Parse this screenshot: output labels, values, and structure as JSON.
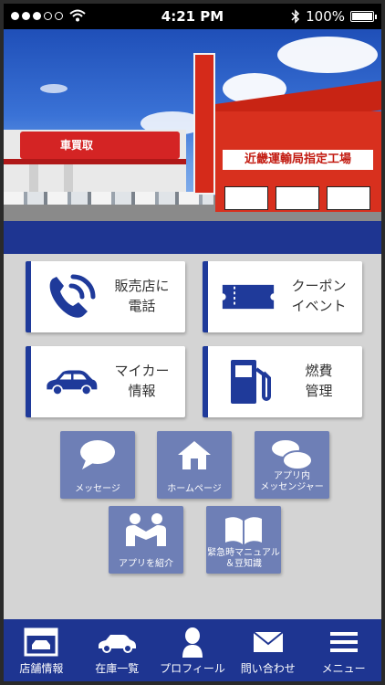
{
  "status_bar": {
    "time": "4:21 PM",
    "battery": "100%",
    "signal_dots_filled": 3,
    "signal_dots_total": 5
  },
  "hero": {
    "sign_left_text": "車買取",
    "sign_band_text": "近畿運輸局指定工場"
  },
  "main_buttons": [
    {
      "id": "call",
      "label": "販売店に\n電話",
      "icon": "phone-icon"
    },
    {
      "id": "coupon",
      "label": "クーポン\nイベント",
      "icon": "ticket-icon"
    },
    {
      "id": "mycar",
      "label": "マイカー\n情報",
      "icon": "car-icon"
    },
    {
      "id": "fuel",
      "label": "燃費\n管理",
      "icon": "fuel-pump-icon"
    }
  ],
  "sub_buttons": [
    {
      "id": "message",
      "label": "メッセージ",
      "icon": "speech-bubble-icon"
    },
    {
      "id": "homepage",
      "label": "ホームページ",
      "icon": "home-icon"
    },
    {
      "id": "messenger",
      "label": "アプリ内\nメッセンジャー",
      "icon": "chat-bubbles-icon"
    },
    {
      "id": "share",
      "label": "アプリを紹介",
      "icon": "people-icon"
    },
    {
      "id": "manual",
      "label": "緊急時マニュアル\n＆豆知識",
      "icon": "book-icon"
    }
  ],
  "tab_bar": [
    {
      "id": "store",
      "label": "店舗情報",
      "icon": "garage-icon"
    },
    {
      "id": "stock",
      "label": "在庫一覧",
      "icon": "car-outline-icon"
    },
    {
      "id": "profile",
      "label": "プロフィール",
      "icon": "person-icon"
    },
    {
      "id": "contact",
      "label": "問い合わせ",
      "icon": "envelope-icon"
    },
    {
      "id": "menu",
      "label": "メニュー",
      "icon": "hamburger-icon"
    }
  ],
  "colors": {
    "navy": "#1e3591",
    "tile_blue": "#6e7fb6",
    "background": "#d4d4d4"
  }
}
